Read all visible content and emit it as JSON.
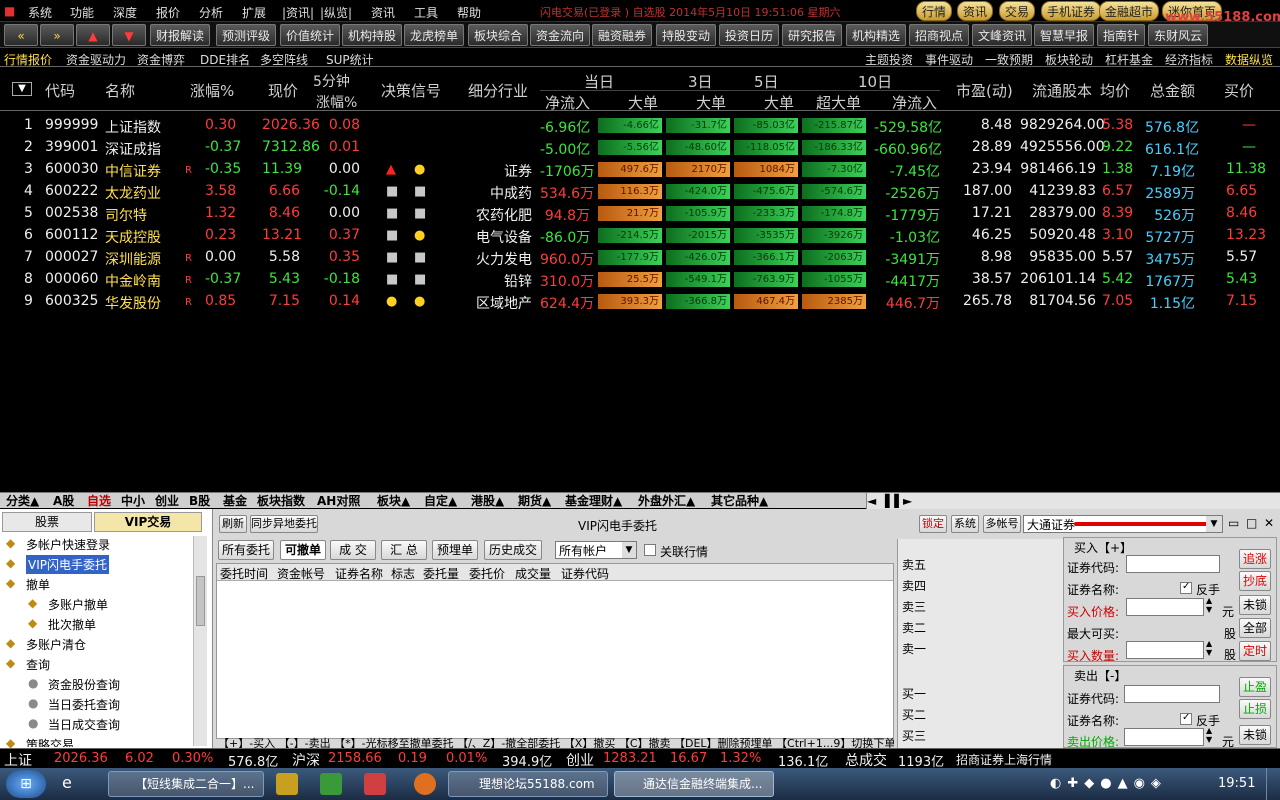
{
  "menubar": {
    "items": [
      "系统",
      "功能",
      "深度",
      "报价",
      "分析",
      "扩展",
      "|资讯|",
      "|纵览|",
      "资讯",
      "工具",
      "帮助"
    ],
    "title_text": "闪电交易(已登录    )  自选股   2014年5月10日  19:51:06  星期六",
    "right_buttons": [
      "行情",
      "资讯",
      "交易",
      "手机证券",
      "金融超市",
      "迷你首页"
    ],
    "watermark": "www.55188.com"
  },
  "toolbar": {
    "buttons": [
      "«",
      "»",
      "▲",
      "▼",
      "财报解读",
      "预测评级",
      "价值统计",
      "机构持股",
      "龙虎榜单",
      "板块综合",
      "资金流向",
      "融资融券",
      "持股变动",
      "投资日历",
      "研究报告",
      "机构精选",
      "招商视点",
      "文峰资讯",
      "智慧早报",
      "指南针",
      "东财风云"
    ]
  },
  "tabs_left": [
    "行情报价",
    "资金驱动力",
    "资金博弈",
    "DDE排名",
    "多空阵线",
    "SUP统计"
  ],
  "tabs_right": [
    "主题投资",
    "事件驱动",
    "一致预期",
    "板块轮动",
    "杠杆基金",
    "经济指标",
    "数据纵览"
  ],
  "grid": {
    "headers": {
      "code": "代码",
      "name": "名称",
      "chg": "涨幅%",
      "price": "现价",
      "m5_top": "5分钟",
      "m5_bot": "涨幅%",
      "signal": "决策信号",
      "industry": "细分行业",
      "today": "当日",
      "d3": "3日",
      "d5": "5日",
      "d10": "10日",
      "netflow": "净流入",
      "bigorder": "大单",
      "bigorder3": "大单",
      "bigorder5": "大单",
      "superbig": "超大单",
      "netflow10": "净流入",
      "pe": "市盈(动)",
      "float": "流通股本",
      "avg": "均价",
      "amount": "总金额",
      "bid": "买价"
    },
    "rows": [
      {
        "idx": "1",
        "code": "999999",
        "name": "上证指数",
        "r": "",
        "chg": "0.30",
        "price": "2026.36",
        "m5": "0.08",
        "sig1": "",
        "sig2": "",
        "ind": "",
        "net": "-6.96亿",
        "b1": "-4.66亿",
        "b3": "-31.7亿",
        "b5": "-85.03亿",
        "b10": "-215.87亿",
        "net10": "-529.58亿",
        "pe": "8.48",
        "flt": "9829264.00",
        "avg": "5.38",
        "amt": "576.8亿",
        "bid": "—"
      },
      {
        "idx": "2",
        "code": "399001",
        "name": "深证成指",
        "r": "",
        "chg": "-0.37",
        "price": "7312.86",
        "m5": "0.01",
        "sig1": "",
        "sig2": "",
        "ind": "",
        "net": "-5.00亿",
        "b1": "-5.56亿",
        "b3": "-48.60亿",
        "b5": "-118.05亿",
        "b10": "-186.33亿",
        "net10": "-660.96亿",
        "pe": "28.89",
        "flt": "4925556.00",
        "avg": "9.22",
        "amt": "616.1亿",
        "bid": "—"
      },
      {
        "idx": "3",
        "code": "600030",
        "name": "中信证券",
        "r": "R",
        "chg": "-0.35",
        "price": "11.39",
        "m5": "0.00",
        "sig1": "tri",
        "sig2": "dot",
        "ind": "证券",
        "net": "-1706万",
        "b1": "497.6万",
        "b3": "2170万",
        "b5": "1084万",
        "b10": "-7.30亿",
        "net10": "-7.45亿",
        "pe": "23.94",
        "flt": "981466.19",
        "avg": "1.38",
        "amt": "7.19亿",
        "bid": "11.38"
      },
      {
        "idx": "4",
        "code": "600222",
        "name": "太龙药业",
        "r": "",
        "chg": "3.58",
        "price": "6.66",
        "m5": "-0.14",
        "sig1": "sq",
        "sig2": "sq",
        "ind": "中成药",
        "net": "534.6万",
        "b1": "116.3万",
        "b3": "-424.0万",
        "b5": "-475.6万",
        "b10": "-574.6万",
        "net10": "-2526万",
        "pe": "187.00",
        "flt": "41239.83",
        "avg": "6.57",
        "amt": "2589万",
        "bid": "6.65"
      },
      {
        "idx": "5",
        "code": "002538",
        "name": "司尔特",
        "r": "",
        "chg": "1.32",
        "price": "8.46",
        "m5": "0.00",
        "sig1": "sq",
        "sig2": "sq",
        "ind": "农药化肥",
        "net": "94.8万",
        "b1": "21.7万",
        "b3": "-105.9万",
        "b5": "-233.3万",
        "b10": "-174.8万",
        "net10": "-1779万",
        "pe": "17.21",
        "flt": "28379.00",
        "avg": "8.39",
        "amt": "526万",
        "bid": "8.46"
      },
      {
        "idx": "6",
        "code": "600112",
        "name": "天成控股",
        "r": "",
        "chg": "0.23",
        "price": "13.21",
        "m5": "0.37",
        "sig1": "sq",
        "sig2": "dot",
        "ind": "电气设备",
        "net": "-86.0万",
        "b1": "-214.5万",
        "b3": "-2015万",
        "b5": "-3535万",
        "b10": "-3926万",
        "net10": "-1.03亿",
        "pe": "46.25",
        "flt": "50920.48",
        "avg": "3.10",
        "amt": "5727万",
        "bid": "13.23"
      },
      {
        "idx": "7",
        "code": "000027",
        "name": "深圳能源",
        "r": "R",
        "chg": "0.00",
        "price": "5.58",
        "m5": "0.35",
        "sig1": "sq",
        "sig2": "sq",
        "ind": "火力发电",
        "net": "960.0万",
        "b1": "-177.9万",
        "b3": "-426.0万",
        "b5": "-366.1万",
        "b10": "-2063万",
        "net10": "-3491万",
        "pe": "8.98",
        "flt": "95835.00",
        "avg": "5.57",
        "amt": "3475万",
        "bid": "5.57"
      },
      {
        "idx": "8",
        "code": "000060",
        "name": "中金岭南",
        "r": "R",
        "chg": "-0.37",
        "price": "5.43",
        "m5": "-0.18",
        "sig1": "sq",
        "sig2": "sq",
        "ind": "铅锌",
        "net": "310.0万",
        "b1": "25.5万",
        "b3": "-549.1万",
        "b5": "-763.9万",
        "b10": "-1055万",
        "net10": "-4417万",
        "pe": "38.57",
        "flt": "206101.14",
        "avg": "5.42",
        "amt": "1767万",
        "bid": "5.43"
      },
      {
        "idx": "9",
        "code": "600325",
        "name": "华发股份",
        "r": "R",
        "chg": "0.85",
        "price": "7.15",
        "m5": "0.14",
        "sig1": "dot",
        "sig2": "dot",
        "ind": "区域地产",
        "net": "624.4万",
        "b1": "393.3万",
        "b3": "-366.8万",
        "b5": "467.4万",
        "b10": "2385万",
        "net10": "446.7万",
        "pe": "265.78",
        "flt": "81704.56",
        "avg": "7.05",
        "amt": "1.15亿",
        "bid": "7.15"
      }
    ]
  },
  "sheet_tabs": [
    "分类▲",
    "A股",
    "自选",
    "中小",
    "创业",
    "B股",
    "基金",
    "板块指数",
    "AH对照",
    "板块▲",
    "自定▲",
    "港股▲",
    "期货▲",
    "基金理财▲",
    "外盘外汇▲",
    "其它品种▲"
  ],
  "left_panel": {
    "tabs": [
      "股票",
      "VIP交易"
    ],
    "items": [
      "多帐户快速登录",
      "VIP闪电手委托",
      "撤单",
      "多账户撤单",
      "批次撤单",
      "多账户清仓",
      "查询",
      "资金股份查询",
      "当日委托查询",
      "当日成交查询",
      "策略交易"
    ]
  },
  "trade": {
    "top_buttons": [
      "刷新",
      "同步异地委托"
    ],
    "title": "VIP闪电手委托",
    "right_buttons": [
      "锁定",
      "系统",
      "多帐号"
    ],
    "broker": "大通证券",
    "tabs": [
      "所有委托",
      "可撤单",
      "成 交",
      "汇 总",
      "预埋单",
      "历史成交"
    ],
    "account_select": "所有帐户",
    "link_label": "关联行情",
    "columns": [
      "委托时间",
      "资金帐号",
      "证券名称",
      "标志",
      "委托量",
      "委托价",
      "成交量",
      "证券代码"
    ],
    "shortcuts": "【+】-买入  【-】-卖出  【*】-光标移至撤单委托  【/、Z】-撤全部委托  【X】撤买  【C】撤卖  【DEL】删除预埋单  【Ctrl+1...9】切换下单帐户",
    "sell_levels": [
      "卖五",
      "卖四",
      "卖三",
      "卖二",
      "卖一"
    ],
    "buy_levels": [
      "买一",
      "买二",
      "买三"
    ],
    "buy_box": {
      "title": "买入【+】",
      "code": "证券代码:",
      "name": "证券名称:",
      "reverse": "反手",
      "price": "买入价格:",
      "unit": "元",
      "max": "最大可买:",
      "share": "股",
      "qty": "买入数量:",
      "btns": [
        "追涨",
        "抄底",
        "未锁",
        "全部",
        "定时"
      ]
    },
    "sell_box": {
      "title": "卖出【-】",
      "code": "证券代码:",
      "name": "证券名称:",
      "reverse": "反手",
      "price": "卖出价格:",
      "unit": "元",
      "btns": [
        "止盈",
        "止损",
        "未锁"
      ]
    }
  },
  "status": {
    "sh_label": "上证",
    "sh_val": "2026.36",
    "sh_chg": "6.02",
    "sh_pct": "0.30%",
    "sh_amt": "576.8亿",
    "hs_label": "沪深",
    "hs_val": "2158.66",
    "hs_chg": "0.19",
    "hs_pct": "0.01%",
    "hs_amt": "394.9亿",
    "cy_label": "创业",
    "cy_val": "1283.21",
    "cy_chg": "16.67",
    "cy_pct": "1.32%",
    "cy_amt": "136.1亿",
    "total_label": "总成交",
    "total_val": "1193亿",
    "feed": "招商证券上海行情"
  },
  "taskbar": {
    "items": [
      "【短线集成二合一】...",
      "理想论坛55188.com",
      "通达信金融终端集成..."
    ],
    "clock": "19:51"
  }
}
